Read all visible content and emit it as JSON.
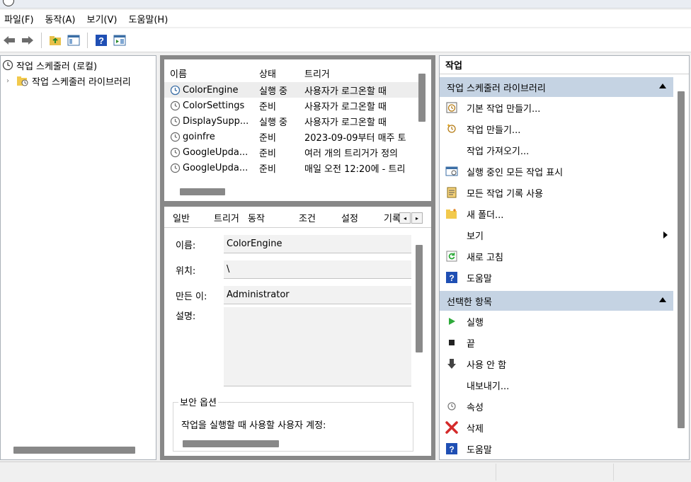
{
  "menu": [
    "파일(F)",
    "동작(A)",
    "보기(V)",
    "도움말(H)"
  ],
  "tree": {
    "root": "작업 스케줄러 (로컬)",
    "child": "작업 스케줄러 라이브러리"
  },
  "tasklist": {
    "headers": [
      "이름",
      "상태",
      "트리거"
    ],
    "rows": [
      {
        "name": "ColorEngine",
        "status": "실행 중",
        "trigger": "사용자가 로그온할 때"
      },
      {
        "name": "ColorSettings",
        "status": "준비",
        "trigger": "사용자가 로그온할 때"
      },
      {
        "name": "DisplaySupp...",
        "status": "실행 중",
        "trigger": "사용자가 로그온할 때"
      },
      {
        "name": "goinfre",
        "status": "준비",
        "trigger": "2023-09-09부터 매주 토"
      },
      {
        "name": "GoogleUpda...",
        "status": "준비",
        "trigger": "여러 개의 트리거가 정의"
      },
      {
        "name": "GoogleUpda...",
        "status": "준비",
        "trigger": "매일 오전 12:20에 - 트리"
      }
    ]
  },
  "details": {
    "tabs": [
      "일반",
      "트리거",
      "동작",
      "조건",
      "설정",
      "기록"
    ],
    "name_label": "이름:",
    "name_value": "ColorEngine",
    "location_label": "위치:",
    "location_value": "\\",
    "author_label": "만든 이:",
    "author_value": "Administrator",
    "desc_label": "설명:",
    "security_title": "보안 옵션",
    "security_text": "작업을 실행할 때 사용할 사용자 계정:"
  },
  "actions": {
    "header": "작업",
    "section1": "작업 스케줄러 라이브러리",
    "items1": [
      {
        "label": "기본 작업 만들기...",
        "icon": "basic-task-icon"
      },
      {
        "label": "작업 만들기...",
        "icon": "create-task-icon"
      },
      {
        "label": "작업 가져오기...",
        "icon": ""
      },
      {
        "label": "실행 중인 모든 작업 표시",
        "icon": "running-tasks-icon"
      },
      {
        "label": "모든 작업 기록 사용",
        "icon": "history-icon"
      },
      {
        "label": "새 폴더...",
        "icon": "folder-icon"
      },
      {
        "label": "보기",
        "icon": "",
        "submenu": true
      },
      {
        "label": "새로 고침",
        "icon": "refresh-icon"
      },
      {
        "label": "도움말",
        "icon": "help-icon"
      }
    ],
    "section2": "선택한 항목",
    "items2": [
      {
        "label": "실행",
        "icon": "run-icon"
      },
      {
        "label": "끝",
        "icon": "end-icon"
      },
      {
        "label": "사용 안 함",
        "icon": "disable-icon"
      },
      {
        "label": "내보내기...",
        "icon": ""
      },
      {
        "label": "속성",
        "icon": "properties-icon"
      },
      {
        "label": "삭제",
        "icon": "delete-icon"
      },
      {
        "label": "도움말",
        "icon": "help-icon"
      }
    ]
  },
  "colors": {
    "section_bg": "#c5d3e3",
    "run_green": "#2eaa3a",
    "delete_red": "#d42a2a",
    "help_blue": "#1f4fb4"
  }
}
